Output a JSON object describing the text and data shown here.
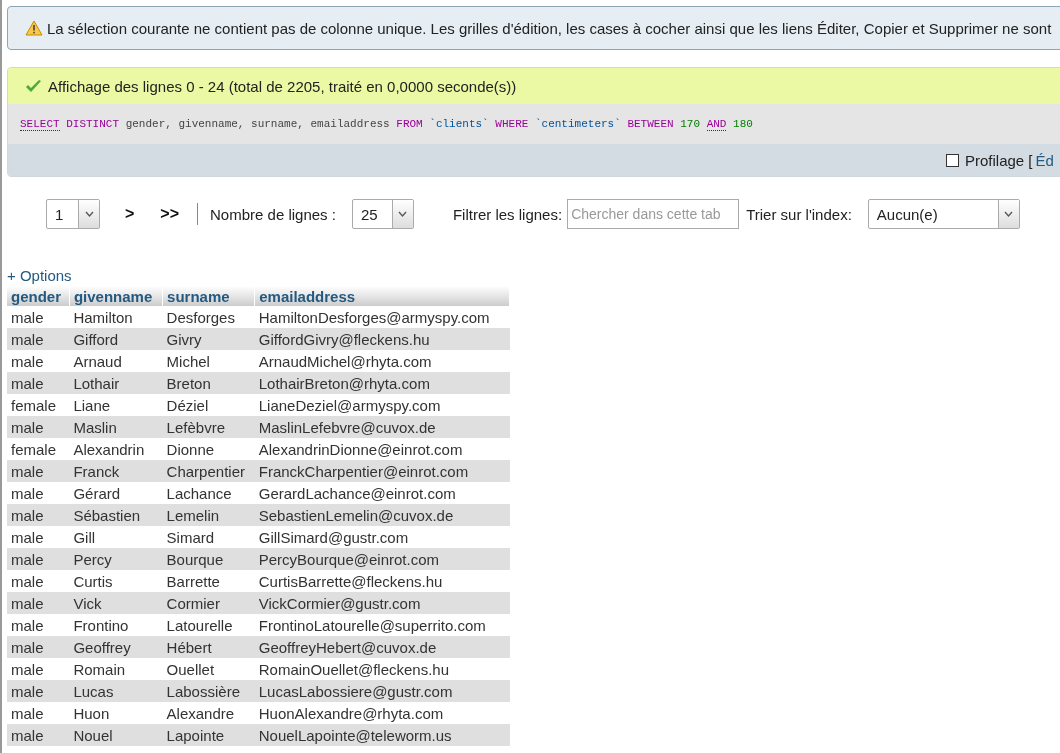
{
  "notice": {
    "text": "La sélection courante ne contient pas de colonne unique. Les grilles d'édition, les cases à cocher ainsi que les liens Éditer, Copier et Supprimer ne sont"
  },
  "result": {
    "message": "Affichage des lignes 0 - 24 (total de 2205, traité en 0,0000 seconde(s))",
    "sql": [
      {
        "text": "SELECT",
        "kind": "doc-keyword"
      },
      {
        "text": "DISTINCT",
        "kind": "keyword"
      },
      {
        "text": "gender, givenname, surname, emailaddress",
        "kind": "plain"
      },
      {
        "text": "FROM",
        "kind": "keyword"
      },
      {
        "text": "`clients`",
        "kind": "identifier"
      },
      {
        "text": "WHERE",
        "kind": "keyword"
      },
      {
        "text": "`centimeters`",
        "kind": "identifier"
      },
      {
        "text": "BETWEEN",
        "kind": "keyword"
      },
      {
        "text": "170",
        "kind": "number"
      },
      {
        "text": "AND",
        "kind": "doc-keyword"
      },
      {
        "text": "180",
        "kind": "number"
      }
    ],
    "profiling": {
      "label": "Profilage [",
      "checked": false,
      "link": "Éd"
    }
  },
  "navigation": {
    "page": "1",
    "next": ">",
    "last": ">>",
    "rows_label": "Nombre de lignes :",
    "rows": "25",
    "filter_label": "Filtrer les lignes:",
    "filter_placeholder": "Chercher dans cette tab",
    "sort_label": "Trier sur l'index:",
    "sort": "Aucun(e)"
  },
  "options_link": "+ Options",
  "table": {
    "columns": [
      "gender",
      "givenname",
      "surname",
      "emailaddress"
    ],
    "rows": [
      [
        "male",
        "Hamilton",
        "Desforges",
        "HamiltonDesforges@armyspy.com"
      ],
      [
        "male",
        "Gifford",
        "Givry",
        "GiffordGivry@fleckens.hu"
      ],
      [
        "male",
        "Arnaud",
        "Michel",
        "ArnaudMichel@rhyta.com"
      ],
      [
        "male",
        "Lothair",
        "Breton",
        "LothairBreton@rhyta.com"
      ],
      [
        "female",
        "Liane",
        "Déziel",
        "LianeDeziel@armyspy.com"
      ],
      [
        "male",
        "Maslin",
        "Lefèbvre",
        "MaslinLefebvre@cuvox.de"
      ],
      [
        "female",
        "Alexandrin",
        "Dionne",
        "AlexandrinDionne@einrot.com"
      ],
      [
        "male",
        "Franck",
        "Charpentier",
        "FranckCharpentier@einrot.com"
      ],
      [
        "male",
        "Gérard",
        "Lachance",
        "GerardLachance@einrot.com"
      ],
      [
        "male",
        "Sébastien",
        "Lemelin",
        "SebastienLemelin@cuvox.de"
      ],
      [
        "male",
        "Gill",
        "Simard",
        "GillSimard@gustr.com"
      ],
      [
        "male",
        "Percy",
        "Bourque",
        "PercyBourque@einrot.com"
      ],
      [
        "male",
        "Curtis",
        "Barrette",
        "CurtisBarrette@fleckens.hu"
      ],
      [
        "male",
        "Vick",
        "Cormier",
        "VickCormier@gustr.com"
      ],
      [
        "male",
        "Frontino",
        "Latourelle",
        "FrontinoLatourelle@superrito.com"
      ],
      [
        "male",
        "Geoffrey",
        "Hébert",
        "GeoffreyHebert@cuvox.de"
      ],
      [
        "male",
        "Romain",
        "Ouellet",
        "RomainOuellet@fleckens.hu"
      ],
      [
        "male",
        "Lucas",
        "Labossière",
        "LucasLabossiere@gustr.com"
      ],
      [
        "male",
        "Huon",
        "Alexandre",
        "HuonAlexandre@rhyta.com"
      ],
      [
        "male",
        "Nouel",
        "Lapointe",
        "NouelLapointe@teleworm.us"
      ]
    ]
  }
}
